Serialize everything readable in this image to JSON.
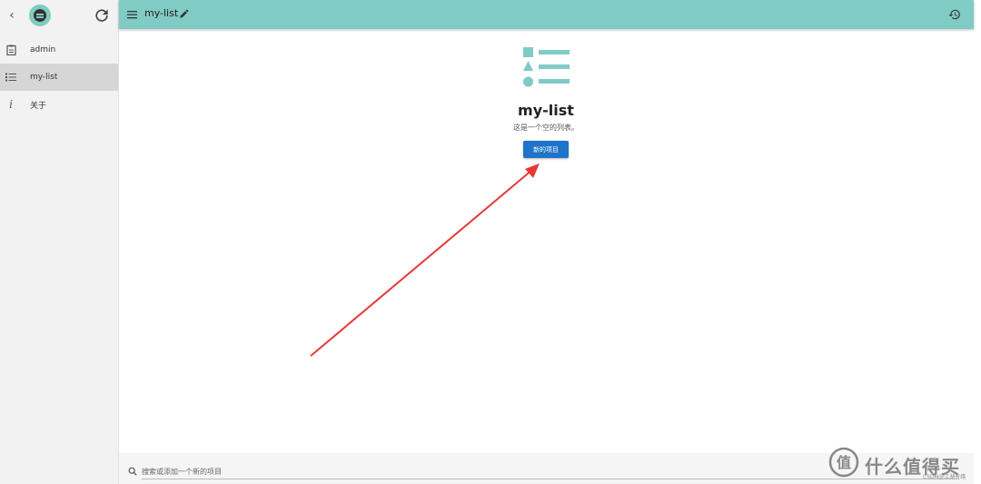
{
  "sidebar": {
    "items": [
      {
        "label": "admin",
        "icon": "clipboard-icon"
      },
      {
        "label": "my-list",
        "icon": "list-icon"
      },
      {
        "label": "关于",
        "icon": "info-icon"
      }
    ]
  },
  "header": {
    "title": "my-list"
  },
  "main": {
    "heading": "my-list",
    "subtitle": "这是一个空的列表。",
    "new_item_button": "新的项目"
  },
  "search": {
    "placeholder": "搜索或添加一个新的项目"
  },
  "watermark": {
    "brand": "什么值得买",
    "small": "CSDN@江湖有缘"
  },
  "colors": {
    "accent": "#80cbc4",
    "button": "#1e74c8",
    "annotation_arrow": "#e53935"
  }
}
